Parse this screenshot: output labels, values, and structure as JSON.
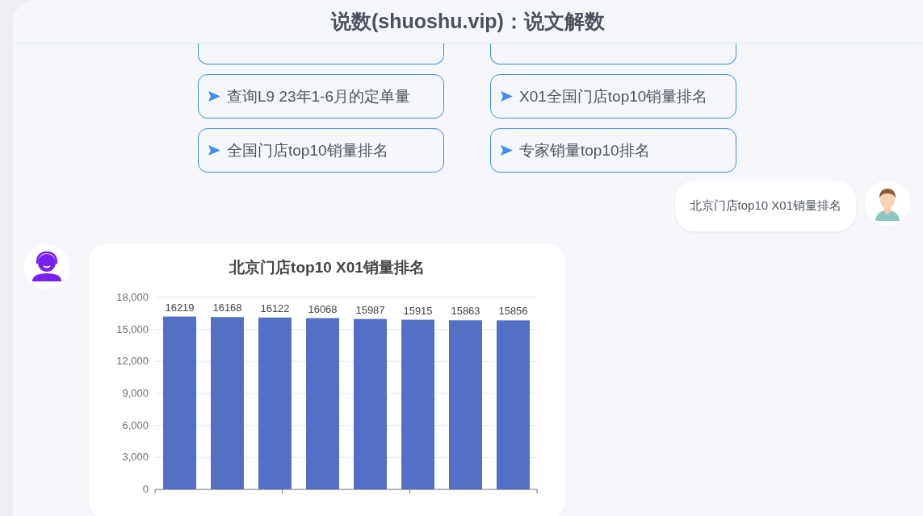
{
  "header": {
    "title": "说数(shuoshu.vip)：说文解数"
  },
  "suggestions": [
    {
      "kind": "cut"
    },
    {
      "kind": "cut"
    },
    {
      "label": "查询L9 23年1-6月的定单量"
    },
    {
      "label": "X01全国门店top10销量排名"
    },
    {
      "label": "全国门店top10销量排名"
    },
    {
      "label": "专家销量top10排名"
    }
  ],
  "messages": [
    {
      "kind": "user",
      "text": "北京门店top10 X01销量排名"
    },
    {
      "kind": "bot",
      "chart_data": {
        "type": "bar",
        "title": "北京门店top10 X01销量排名",
        "grid": true,
        "values": [
          16219,
          16168,
          16122,
          16068,
          15987,
          15915,
          15863,
          15856
        ],
        "ylim": [
          0,
          18000
        ],
        "yticks": [
          {
            "value": 0,
            "label": "0"
          },
          {
            "value": 3000,
            "label": "3,000"
          },
          {
            "value": 6000,
            "label": "6,000"
          },
          {
            "value": 9000,
            "label": "9,000"
          },
          {
            "value": 12000,
            "label": "12,000"
          },
          {
            "value": 15000,
            "label": "15,000"
          },
          {
            "value": 18000,
            "label": "18,000"
          }
        ],
        "data_labels": true
      }
    }
  ]
}
